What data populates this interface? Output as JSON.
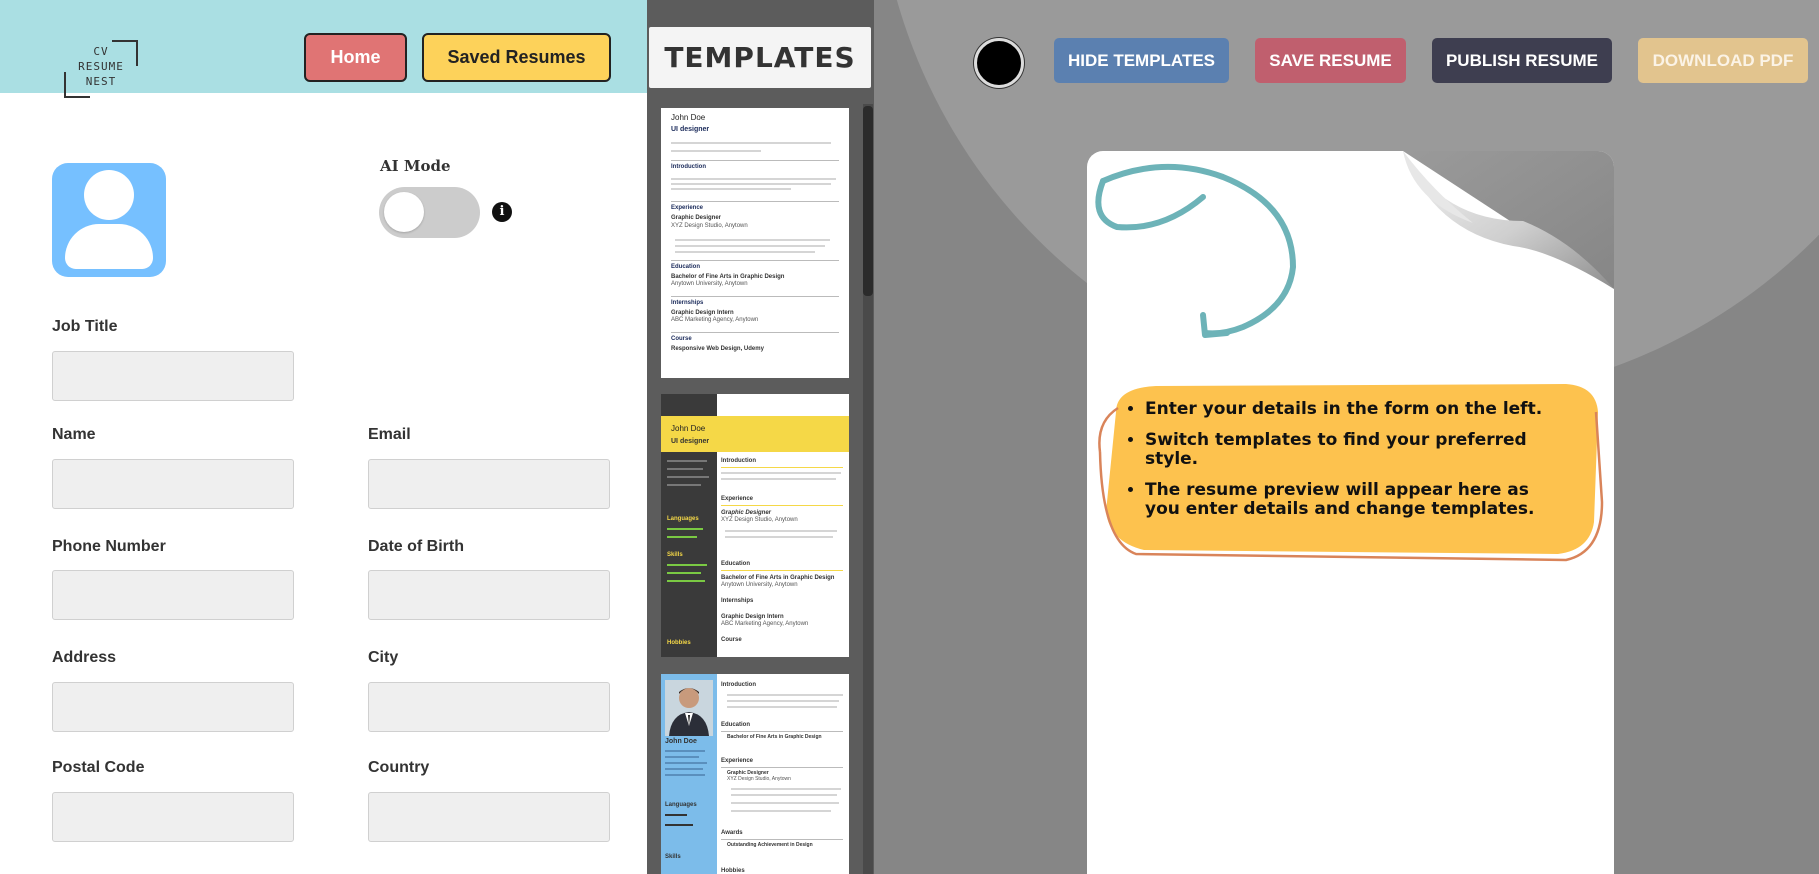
{
  "header": {
    "logo_lines": [
      "CV",
      "RESUME",
      "NEST"
    ],
    "home_label": "Home",
    "saved_label": "Saved Resumes"
  },
  "ai_mode": {
    "label": "AI Mode",
    "enabled": false,
    "info_glyph": "i"
  },
  "form": {
    "fields": [
      {
        "id": "job-title",
        "label": "Job Title",
        "value": ""
      },
      {
        "id": "name",
        "label": "Name",
        "value": ""
      },
      {
        "id": "email",
        "label": "Email",
        "value": ""
      },
      {
        "id": "phone",
        "label": "Phone Number",
        "value": ""
      },
      {
        "id": "dob",
        "label": "Date of Birth",
        "value": ""
      },
      {
        "id": "address",
        "label": "Address",
        "value": ""
      },
      {
        "id": "city",
        "label": "City",
        "value": ""
      },
      {
        "id": "postal",
        "label": "Postal Code",
        "value": ""
      },
      {
        "id": "country",
        "label": "Country",
        "value": ""
      }
    ]
  },
  "templates": {
    "title": "TEMPLATES",
    "items": [
      {
        "name": "John Doe",
        "role": "UI designer",
        "sections": [
          "Introduction",
          "Experience",
          "Education",
          "Internships",
          "Course"
        ],
        "details": [
          "Graphic Designer",
          "XYZ Design Studio, Anytown",
          "Bachelor of Fine Arts in Graphic Design",
          "Anytown University, Anytown",
          "Graphic Design Intern",
          "ABC Marketing Agency, Anytown",
          "Responsive Web Design, Udemy"
        ]
      },
      {
        "name": "John Doe",
        "role": "UI designer",
        "sections": [
          "Introduction",
          "Experience",
          "Education",
          "Internships",
          "Course"
        ],
        "side_sections": [
          "Languages",
          "Skills",
          "Hobbies"
        ],
        "details": [
          "Graphic Designer",
          "XYZ Design Studio, Anytown",
          "Bachelor of Fine Arts in Graphic Design",
          "Anytown University, Anytown",
          "Graphic Design Intern",
          "ABC Marketing Agency, Anytown"
        ]
      },
      {
        "name": "John Doe",
        "sections": [
          "Introduction",
          "Education",
          "Experience",
          "Awards",
          "Hobbies"
        ],
        "side_sections": [
          "Languages",
          "Skills"
        ],
        "details": [
          "Bachelor of Fine Arts in Graphic Design",
          "Graphic Designer",
          "XYZ Design Studio, Anytown",
          "Outstanding Achievement in Design"
        ]
      }
    ]
  },
  "toolbar": {
    "hide_templates": "HIDE TEMPLATES",
    "save": "SAVE RESUME",
    "publish": "PUBLISH RESUME",
    "download": "DOWNLOAD PDF",
    "theme_color": "#000000"
  },
  "preview": {
    "tips": [
      "Enter your details in the form on the left.",
      "Switch templates to find your preferred style.",
      "The resume preview will appear here as you enter details and change templates."
    ]
  },
  "colors": {
    "header_bg": "#aadfe3",
    "home_btn": "#e07474",
    "saved_btn": "#fdd25a",
    "avatar_bg": "#76c0ff",
    "hide_btn": "#5b80b0",
    "save_btn": "#c05f6e",
    "publish_btn": "#3e3e50",
    "download_btn": "#e2c48e",
    "tips_card": "#fdc24e",
    "arrow": "#6db3b8"
  }
}
